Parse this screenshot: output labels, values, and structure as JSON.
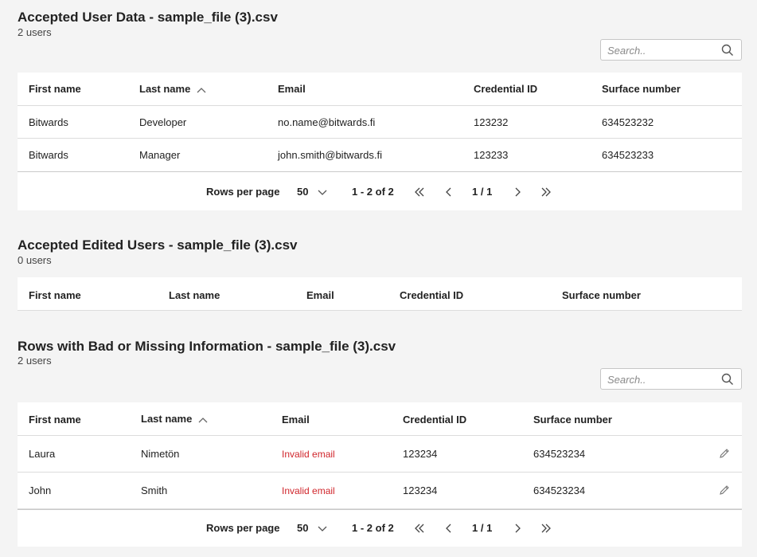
{
  "sections": [
    {
      "title": "Accepted User Data - sample_file (3).csv",
      "count": "2 users",
      "search_placeholder": "Search..",
      "columns": [
        "First name",
        "Last name",
        "Email",
        "Credential ID",
        "Surface number"
      ],
      "rows": [
        {
          "first": "Bitwards",
          "last": "Developer",
          "email": "no.name@bitwards.fi",
          "credential": "123232",
          "surface": "634523232"
        },
        {
          "first": "Bitwards",
          "last": "Manager",
          "email": "john.smith@bitwards.fi",
          "credential": "123233",
          "surface": "634523233"
        }
      ],
      "pager": {
        "rows_per_page_label": "Rows per page",
        "rows_per_page": "50",
        "range": "1 - 2 of 2",
        "page": "1 / 1"
      }
    },
    {
      "title": "Accepted Edited Users - sample_file (3).csv",
      "count": "0 users",
      "columns": [
        "First name",
        "Last name",
        "Email",
        "Credential ID",
        "Surface number"
      ]
    },
    {
      "title": "Rows with Bad or Missing Information - sample_file (3).csv",
      "count": "2 users",
      "search_placeholder": "Search..",
      "columns": [
        "First name",
        "Last name",
        "Email",
        "Credential ID",
        "Surface number"
      ],
      "rows": [
        {
          "first": "Laura",
          "last": "Nimetön",
          "email": "Invalid email",
          "credential": "123234",
          "surface": "634523234"
        },
        {
          "first": "John",
          "last": "Smith",
          "email": "Invalid email",
          "credential": "123234",
          "surface": "634523234"
        }
      ],
      "pager": {
        "rows_per_page_label": "Rows per page",
        "rows_per_page": "50",
        "range": "1 - 2 of 2",
        "page": "1 / 1"
      }
    }
  ],
  "colors": {
    "invalid": "#d0262c",
    "background": "#f4f4f4",
    "card": "#ffffff"
  }
}
